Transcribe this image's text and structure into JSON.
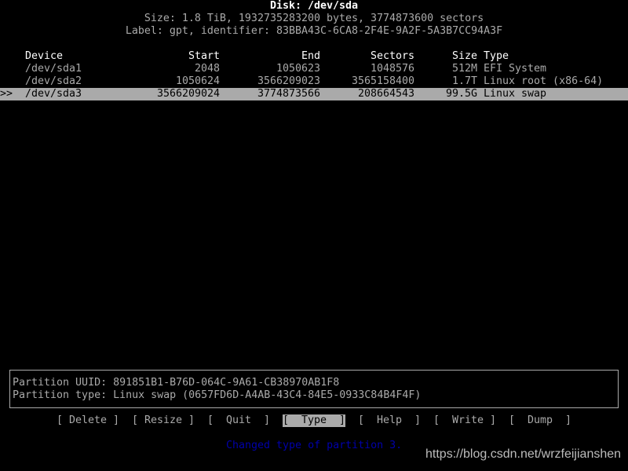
{
  "header": {
    "title": "Disk: /dev/sda",
    "size_line": "Size: 1.8 TiB, 1932735283200 bytes, 3774873600 sectors",
    "label_line": "Label: gpt, identifier: 83BBA43C-6CA8-2F4E-9A2F-5A3B7CC94A3F"
  },
  "table": {
    "columns": {
      "device": "Device",
      "start": "Start",
      "end": "End",
      "sectors": "Sectors",
      "size": "Size",
      "type": "Type"
    },
    "selected_marker": ">>",
    "rows": [
      {
        "device": "/dev/sda1",
        "start": "2048",
        "end": "1050623",
        "sectors": "1048576",
        "size": "512M",
        "type": "EFI System"
      },
      {
        "device": "/dev/sda2",
        "start": "1050624",
        "end": "3566209023",
        "sectors": "3565158400",
        "size": "1.7T",
        "type": "Linux root (x86-64)"
      },
      {
        "device": "/dev/sda3",
        "start": "3566209024",
        "end": "3774873566",
        "sectors": "208664543",
        "size": "99.5G",
        "type": "Linux swap",
        "selected": true
      }
    ]
  },
  "info": {
    "uuid_line": "Partition UUID: 891851B1-B76D-064C-9A61-CB38970AB1F8",
    "type_line": "Partition type: Linux swap (0657FD6D-A4AB-43C4-84E5-0933C84B4F4F)"
  },
  "menu": {
    "delete": "[ Delete ]",
    "resize": "[ Resize ]",
    "quit": "[  Quit  ]",
    "type": "[  Type  ]",
    "help": "[  Help  ]",
    "write": "[  Write ]",
    "dump": "[  Dump  ]",
    "selected": "type"
  },
  "status": "Changed type of partition 3.",
  "watermark": "https://blog.csdn.net/wrzfeijianshen",
  "colors": {
    "background": "#000000",
    "text": "#aaaaaa",
    "highlight": "#aaaaaa",
    "status": "#0000aa"
  }
}
